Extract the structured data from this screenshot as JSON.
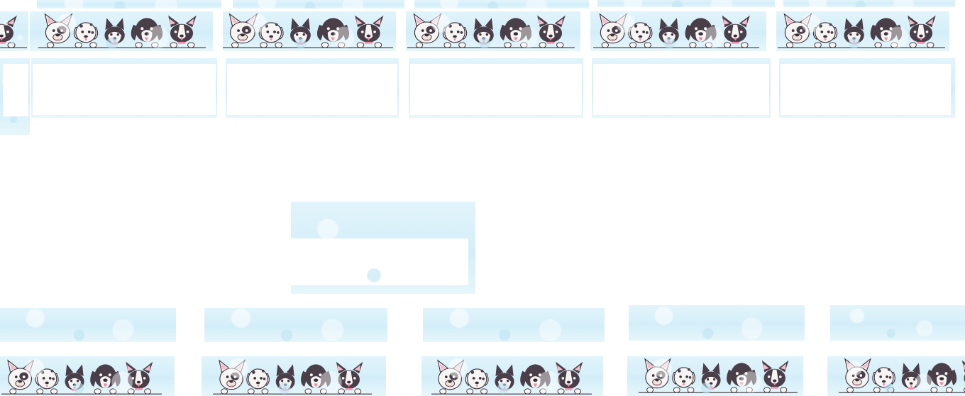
{
  "theme": {
    "wash_color": "#d3eef9",
    "dark_fur": "#4a3e48",
    "light_fur": "#f7f4f4",
    "ear_pink": "#f4bcc8",
    "tongue_pink": "#ec8fa7",
    "outline": "#3a3039"
  },
  "top_row": {
    "tiles": [
      {
        "icon": "puppies-border-icon"
      },
      {
        "icon": "puppies-border-icon"
      },
      {
        "icon": "puppies-border-icon"
      },
      {
        "icon": "puppies-border-icon"
      },
      {
        "icon": "puppies-border-icon"
      },
      {
        "icon": "puppies-border-icon"
      }
    ]
  },
  "middle_tile": {
    "icon": "blank-card-icon"
  },
  "bottom_row": {
    "tiles": [
      {
        "icon": "puppies-border-icon"
      },
      {
        "icon": "puppies-border-icon"
      },
      {
        "icon": "puppies-border-icon"
      },
      {
        "icon": "puppies-border-icon"
      },
      {
        "icon": "puppies-border-icon"
      }
    ]
  }
}
